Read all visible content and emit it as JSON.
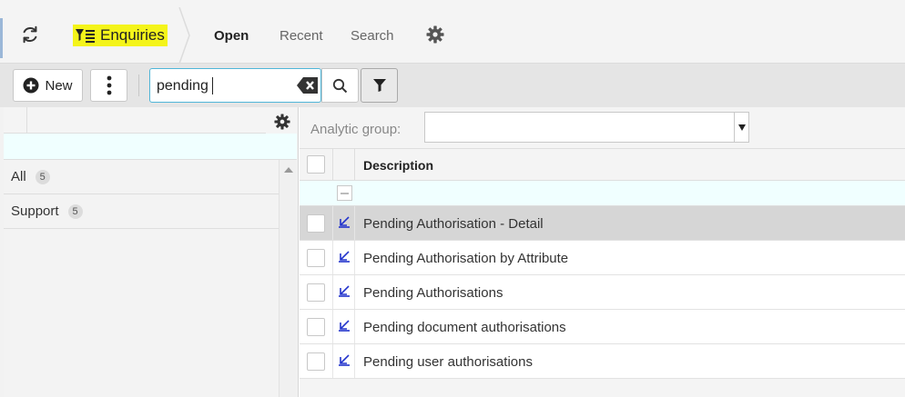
{
  "nav": {
    "module_label": "Enquiries",
    "tabs": [
      {
        "label": "Open",
        "active": true
      },
      {
        "label": "Recent",
        "active": false
      },
      {
        "label": "Search",
        "active": false
      }
    ],
    "icons": {
      "refresh": "refresh-icon",
      "module": "filter-list-icon",
      "settings": "gear-icon"
    }
  },
  "toolbar": {
    "new_label": "New",
    "search": {
      "value": "pending",
      "placeholder": ""
    },
    "icons": {
      "new": "plus-circle-icon",
      "more": "vertical-dots-icon",
      "clear": "backspace-icon",
      "search": "magnifier-icon",
      "filter": "funnel-icon"
    }
  },
  "sidebar": {
    "items": [
      {
        "label": "All",
        "count": "5"
      },
      {
        "label": "Support",
        "count": "5"
      }
    ]
  },
  "analytic_group": {
    "label": "Analytic group:",
    "value": ""
  },
  "grid": {
    "column_description": "Description",
    "rows": [
      {
        "text": "Pending Authorisation - Detail",
        "selected": true
      },
      {
        "text": "Pending Authorisation by Attribute",
        "selected": false
      },
      {
        "text": "Pending Authorisations",
        "selected": false
      },
      {
        "text": "Pending document authorisations",
        "selected": false
      },
      {
        "text": "Pending user authorisations",
        "selected": false
      }
    ]
  },
  "colors": {
    "highlight": "#f4f41a",
    "accent_border": "#4fb6d8",
    "row_icon": "#2233cc",
    "selected_row": "#d6d6d6",
    "filter_row": "#f0ffff"
  }
}
